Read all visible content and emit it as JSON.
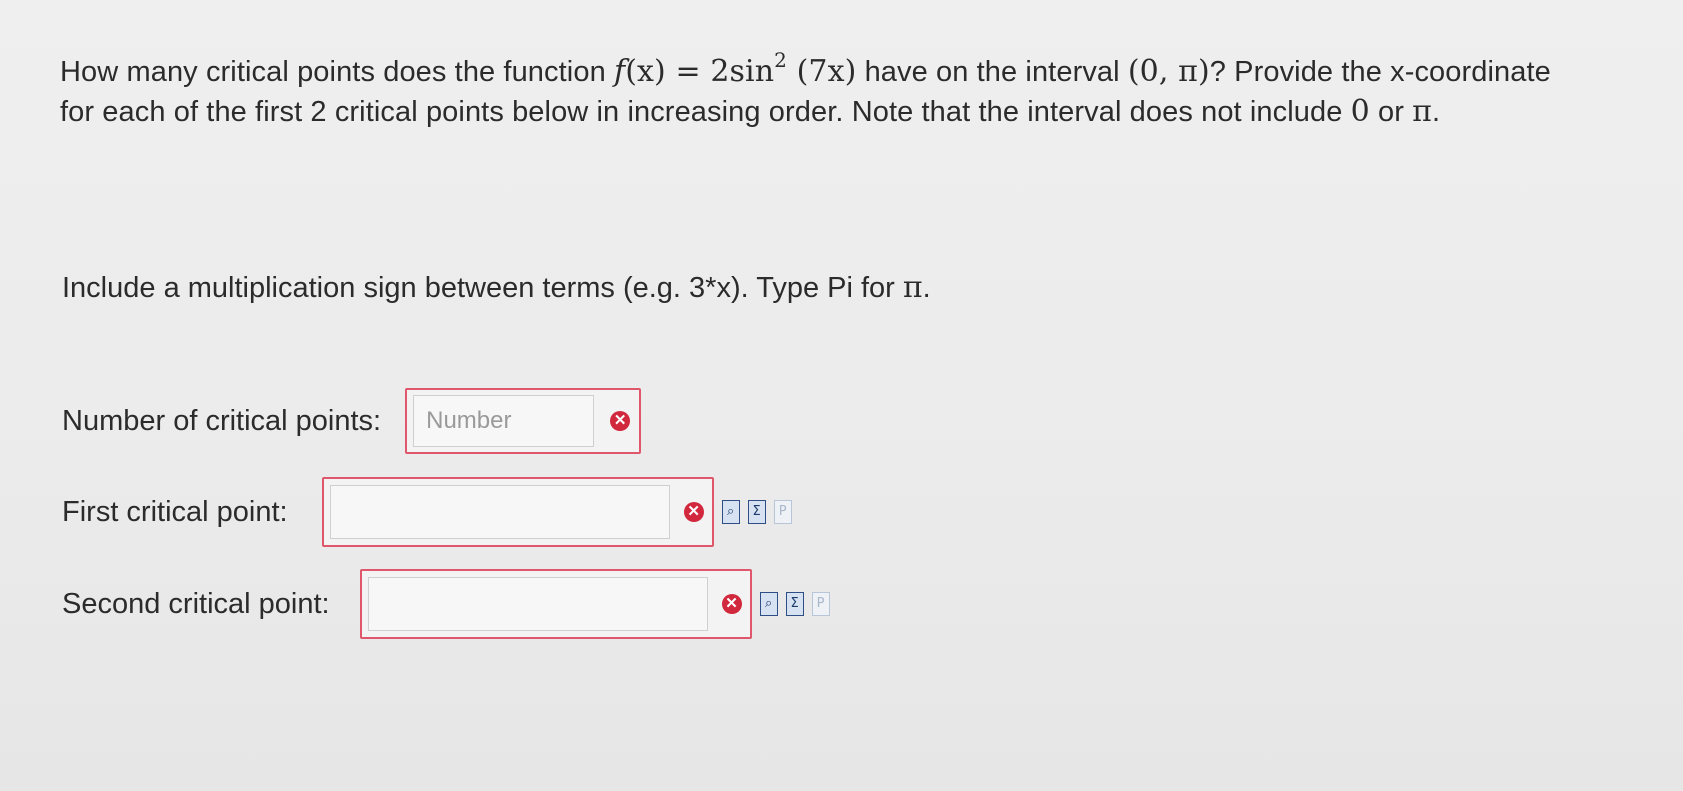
{
  "question": {
    "part1": "How many critical points does the function ",
    "func_name": "f",
    "func_arg": "(x)",
    "equals": " = 2sin",
    "exponent": "2",
    "func_inner": " (7x)",
    "part2": " have on the interval ",
    "interval": "(0, π)",
    "part3": "? Provide the x-coordinate for each of the first 2 critical points below in increasing order. Note that the interval does not include ",
    "zero": "0",
    "or_text": " or ",
    "pi": "π",
    "end": "."
  },
  "instructions": {
    "text": "Include a multiplication sign between terms (e.g. 3*x). Type Pi for ",
    "pi": "π",
    "end": "."
  },
  "fields": {
    "count": {
      "label": "Number of critical points:",
      "placeholder": "Number",
      "value": ""
    },
    "first": {
      "label": "First critical point:",
      "placeholder": "",
      "value": ""
    },
    "second": {
      "label": "Second critical point:",
      "placeholder": "",
      "value": ""
    }
  },
  "icons": {
    "error": "✕",
    "preview": "⌕",
    "equation_editor": "Σ",
    "help": "P"
  },
  "colors": {
    "error_border": "#e0566b",
    "error_icon": "#d1283e",
    "tool_icon": "#2d4f86"
  }
}
